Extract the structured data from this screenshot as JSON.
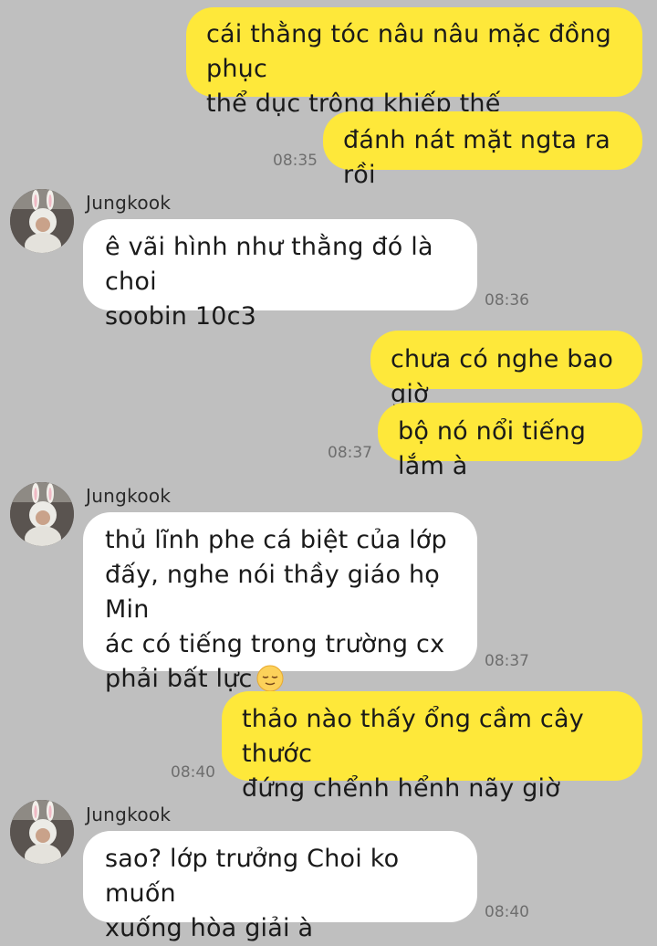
{
  "contact": {
    "name": "Jungkook",
    "avatar_icon": "bunny-costume-avatar-icon"
  },
  "colors": {
    "background": "#bfbfbf",
    "outgoing_bubble": "#fee83a",
    "incoming_bubble": "#ffffff"
  },
  "messages": [
    {
      "direction": "out",
      "lines": [
        "cái thằng tóc nâu nâu mặc đồng phục",
        "thể dục trông khiếp thế"
      ]
    },
    {
      "direction": "out",
      "lines": [
        "đánh nát mặt ngta ra rồi"
      ],
      "time": "08:35"
    },
    {
      "direction": "in",
      "sender": "Jungkook",
      "lines": [
        "ê vãi hình như thằng đó là choi",
        "soobin 10c3"
      ],
      "time": "08:36"
    },
    {
      "direction": "out",
      "lines": [
        "chưa có nghe bao giờ"
      ]
    },
    {
      "direction": "out",
      "lines": [
        "bộ nó nổi tiếng lắm à"
      ],
      "time": "08:37"
    },
    {
      "direction": "in",
      "sender": "Jungkook",
      "lines": [
        "thủ lĩnh phe cá biệt của lớp",
        "đấy, nghe nói thầy giáo họ Min",
        "ác có tiếng trong trường cx",
        "phải bất lực"
      ],
      "emoji": "relieved-face-emoji",
      "time": "08:37"
    },
    {
      "direction": "out",
      "lines": [
        "thảo nào thấy ổng cầm cây thước",
        "đứng chểnh hểnh nãy giờ"
      ],
      "time": "08:40"
    },
    {
      "direction": "in",
      "sender": "Jungkook",
      "lines": [
        "sao? lớp trưởng Choi ko muốn",
        "xuống hòa giải à"
      ],
      "time": "08:40"
    }
  ]
}
